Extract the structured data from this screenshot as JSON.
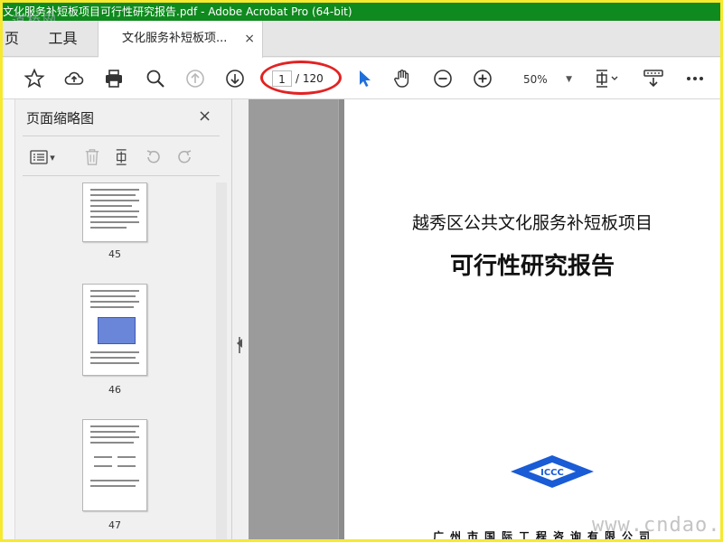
{
  "window": {
    "title": "文化服务补短板项目可行性研究报告.pdf - Adobe Acrobat Pro (64-bit)",
    "watermark_top": "道桥网"
  },
  "tabs": {
    "home": "页",
    "tools": "工具",
    "document": "文化服务补短板项...",
    "close": "×"
  },
  "toolbar": {
    "page_current": "1",
    "page_total": "/ 120",
    "zoom": "50%",
    "zoom_arrow": "▼"
  },
  "thumbnail_panel": {
    "title": "页面缩略图",
    "close": "×",
    "options_arrow": "▾",
    "pages": [
      {
        "label": "45"
      },
      {
        "label": "46"
      },
      {
        "label": "47"
      }
    ]
  },
  "document": {
    "title_line1": "越秀区公共文化服务补短板项目",
    "title_line2": "可行性研究报告",
    "logo_text": "ICCC",
    "footer": "广州市国际工程咨询有限公司"
  },
  "watermark_bottom": "www.cndao.com",
  "colors": {
    "title_bar": "#0f8a1e",
    "border": "#f6e92e",
    "annotation_oval": "#e32222",
    "select_cursor": "#1e6fd9",
    "logo_blue": "#1a5bd6"
  }
}
